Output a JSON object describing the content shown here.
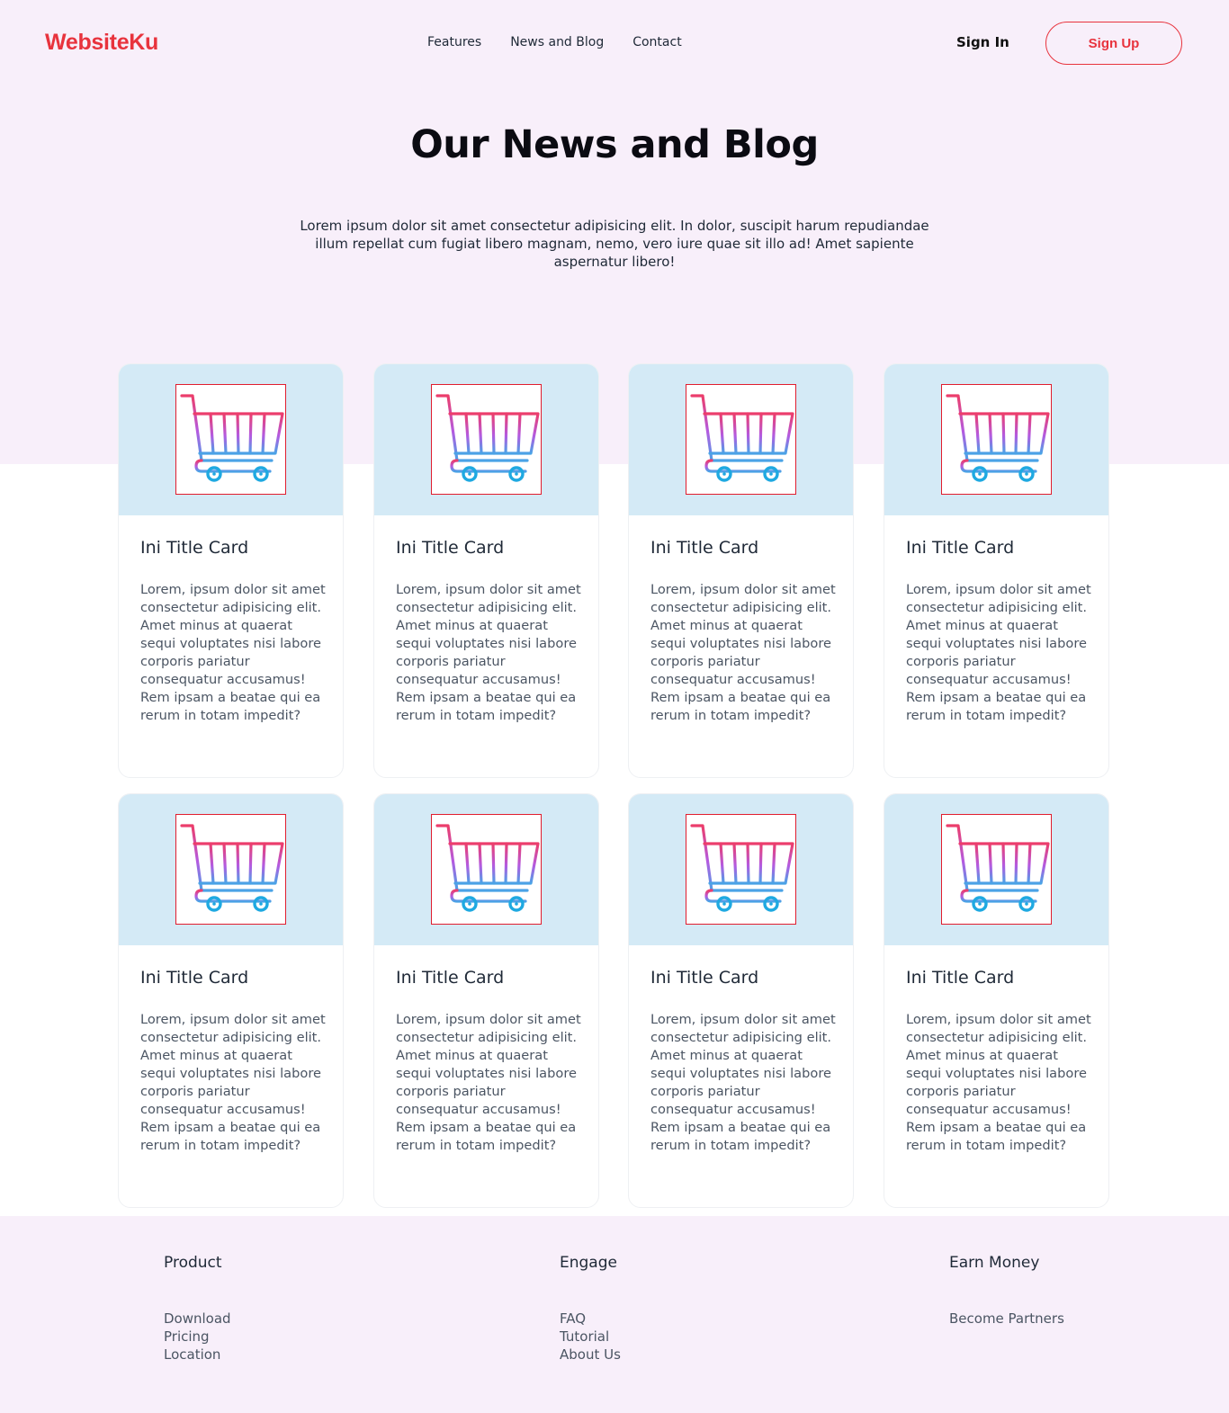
{
  "brand": {
    "name": "WebsiteKu",
    "color": "#e8333d"
  },
  "nav": {
    "items": [
      "Features",
      "News and Blog",
      "Contact"
    ]
  },
  "auth": {
    "signin_label": "Sign In",
    "signup_label": "Sign Up"
  },
  "hero": {
    "title": "Our News and Blog",
    "text": "Lorem ipsum dolor sit amet consectetur adipisicing elit. In dolor, suscipit harum repudiandae illum repellat cum fugiat libero magnam, nemo, vero iure quae sit illo ad! Amet sapiente aspernatur libero!"
  },
  "cards": [
    {
      "icon": "shopping-cart-icon",
      "title": "Ini Title Card",
      "text": "Lorem, ipsum dolor sit amet consectetur adipisicing elit. Amet minus at quaerat sequi voluptates nisi labore corporis pariatur consequatur accusamus! Rem ipsam a beatae qui ea rerum in totam impedit?"
    },
    {
      "icon": "shopping-cart-icon",
      "title": "Ini Title Card",
      "text": "Lorem, ipsum dolor sit amet consectetur adipisicing elit. Amet minus at quaerat sequi voluptates nisi labore corporis pariatur consequatur accusamus! Rem ipsam a beatae qui ea rerum in totam impedit?"
    },
    {
      "icon": "shopping-cart-icon",
      "title": "Ini Title Card",
      "text": "Lorem, ipsum dolor sit amet consectetur adipisicing elit. Amet minus at quaerat sequi voluptates nisi labore corporis pariatur consequatur accusamus! Rem ipsam a beatae qui ea rerum in totam impedit?"
    },
    {
      "icon": "shopping-cart-icon",
      "title": "Ini Title Card",
      "text": "Lorem, ipsum dolor sit amet consectetur adipisicing elit. Amet minus at quaerat sequi voluptates nisi labore corporis pariatur consequatur accusamus! Rem ipsam a beatae qui ea rerum in totam impedit?"
    },
    {
      "icon": "shopping-cart-icon",
      "title": "Ini Title Card",
      "text": "Lorem, ipsum dolor sit amet consectetur adipisicing elit. Amet minus at quaerat sequi voluptates nisi labore corporis pariatur consequatur accusamus! Rem ipsam a beatae qui ea rerum in totam impedit?"
    },
    {
      "icon": "shopping-cart-icon",
      "title": "Ini Title Card",
      "text": "Lorem, ipsum dolor sit amet consectetur adipisicing elit. Amet minus at quaerat sequi voluptates nisi labore corporis pariatur consequatur accusamus! Rem ipsam a beatae qui ea rerum in totam impedit?"
    },
    {
      "icon": "shopping-cart-icon",
      "title": "Ini Title Card",
      "text": "Lorem, ipsum dolor sit amet consectetur adipisicing elit. Amet minus at quaerat sequi voluptates nisi labore corporis pariatur consequatur accusamus! Rem ipsam a beatae qui ea rerum in totam impedit?"
    },
    {
      "icon": "shopping-cart-icon",
      "title": "Ini Title Card",
      "text": "Lorem, ipsum dolor sit amet consectetur adipisicing elit. Amet minus at quaerat sequi voluptates nisi labore corporis pariatur consequatur accusamus! Rem ipsam a beatae qui ea rerum in totam impedit?"
    }
  ],
  "footer": {
    "columns": [
      {
        "title": "Product",
        "links": [
          "Download",
          "Pricing",
          "Location"
        ]
      },
      {
        "title": "Engage",
        "links": [
          "FAQ",
          "Tutorial",
          "About Us"
        ]
      },
      {
        "title": "Earn Money",
        "links": [
          "Become Partners"
        ]
      }
    ]
  },
  "colors": {
    "hero_bg": "#f8effa",
    "card_top": "#d4eaf6",
    "accent": "#e8333d"
  }
}
